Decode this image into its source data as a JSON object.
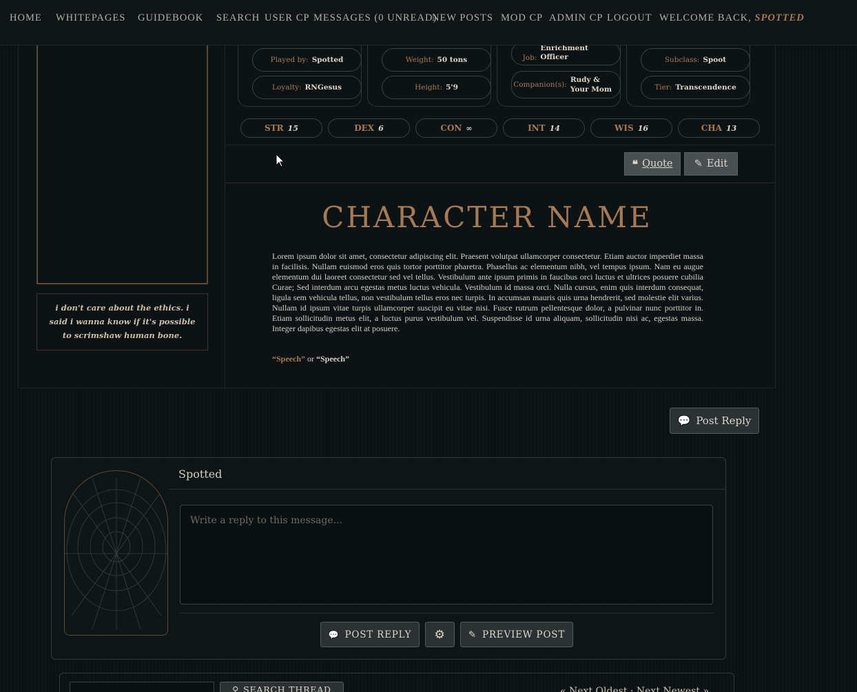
{
  "nav": {
    "items": [
      "Home",
      "Whitepages",
      "Guidebook",
      "Search",
      "User CP",
      "Messages (0 Unread)",
      "New Posts",
      "Mod CP",
      "Admin CP",
      "Logout"
    ],
    "welcome": "Welcome back,",
    "username": "Spotted"
  },
  "stats": {
    "groups": [
      [
        {
          "label": "Played by:",
          "value": "Spotted"
        },
        {
          "label": "Loyalty:",
          "value": "RNGesus"
        }
      ],
      [
        {
          "label": "Weight:",
          "value": "50 tons"
        },
        {
          "label": "Height:",
          "value": "5'9"
        }
      ],
      [
        {
          "label": "Job:",
          "value": "Setting Enrichment Officer"
        },
        {
          "label": "Companion(s):",
          "value": "Rudy & Your Mom"
        }
      ],
      [
        {
          "label": "Subclass:",
          "value": "Spoot"
        },
        {
          "label": "Tier:",
          "value": "Transcendence"
        }
      ]
    ],
    "abilities": [
      {
        "name": "STR",
        "value": "15"
      },
      {
        "name": "DEX",
        "value": "6"
      },
      {
        "name": "CON",
        "value": "∞"
      },
      {
        "name": "INT",
        "value": "14"
      },
      {
        "name": "WIS",
        "value": "16"
      },
      {
        "name": "CHA",
        "value": "13"
      }
    ]
  },
  "post": {
    "quote_label": "Quote",
    "edit_label": "Edit",
    "character_name": "CHARACTER NAME",
    "quote": "i don't care about the ethics. i said i wanna know if it's possible to scrimshaw human bone.",
    "body": "Lorem ipsum dolor sit amet, consectetur adipiscing elit. Praesent volutpat ullamcorper consectetur. Etiam auctor imperdiet massa in facilisis. Nullam euismod eros quis tortor porttitor pharetra. Phasellus ac elementum nibh, vel tempus ipsum. Nam eu augue elementum dui laoreet consectetur sed vel tellus. Vestibulum ante ipsum primis in faucibus orci luctus et ultrices posuere cubilia Curae; Sed interdum arcu egestas metus luctus vehicula. Vestibulum id massa orci. Nulla cursus, enim quis interdum consequat, ligula sem vehicula tellus, non vestibulum tellus eros nec turpis. In accumsan mauris quis urna hendrerit, sed molestie elit varius. Nullam id ipsum vitae turpis ullamcorper suscipit eu vitae nisi. Fusce rutrum pellentesque dolor, a pulvinar nunc porttitor in. Etiam sollicitudin metus elit, a luctus purus vestibulum vel. Suspendisse id urna aliquam, sollicitudin nisi ac, egestas massa. Integer dapibus egestas elit at posuere.",
    "speech1": "“Speech”",
    "speech_or": " or ",
    "speech2": "“Speech”"
  },
  "reply": {
    "top_button": "Post Reply",
    "username": "Spotted",
    "placeholder": "Write a reply to this message...",
    "post_reply": "Post Reply",
    "preview": "Preview Post"
  },
  "footer": {
    "search_thread": "Search Thread",
    "pager": "« Next Oldest · Next Newest »"
  },
  "colors": {
    "accent": "#a67a55",
    "discord": "#5865f2"
  }
}
